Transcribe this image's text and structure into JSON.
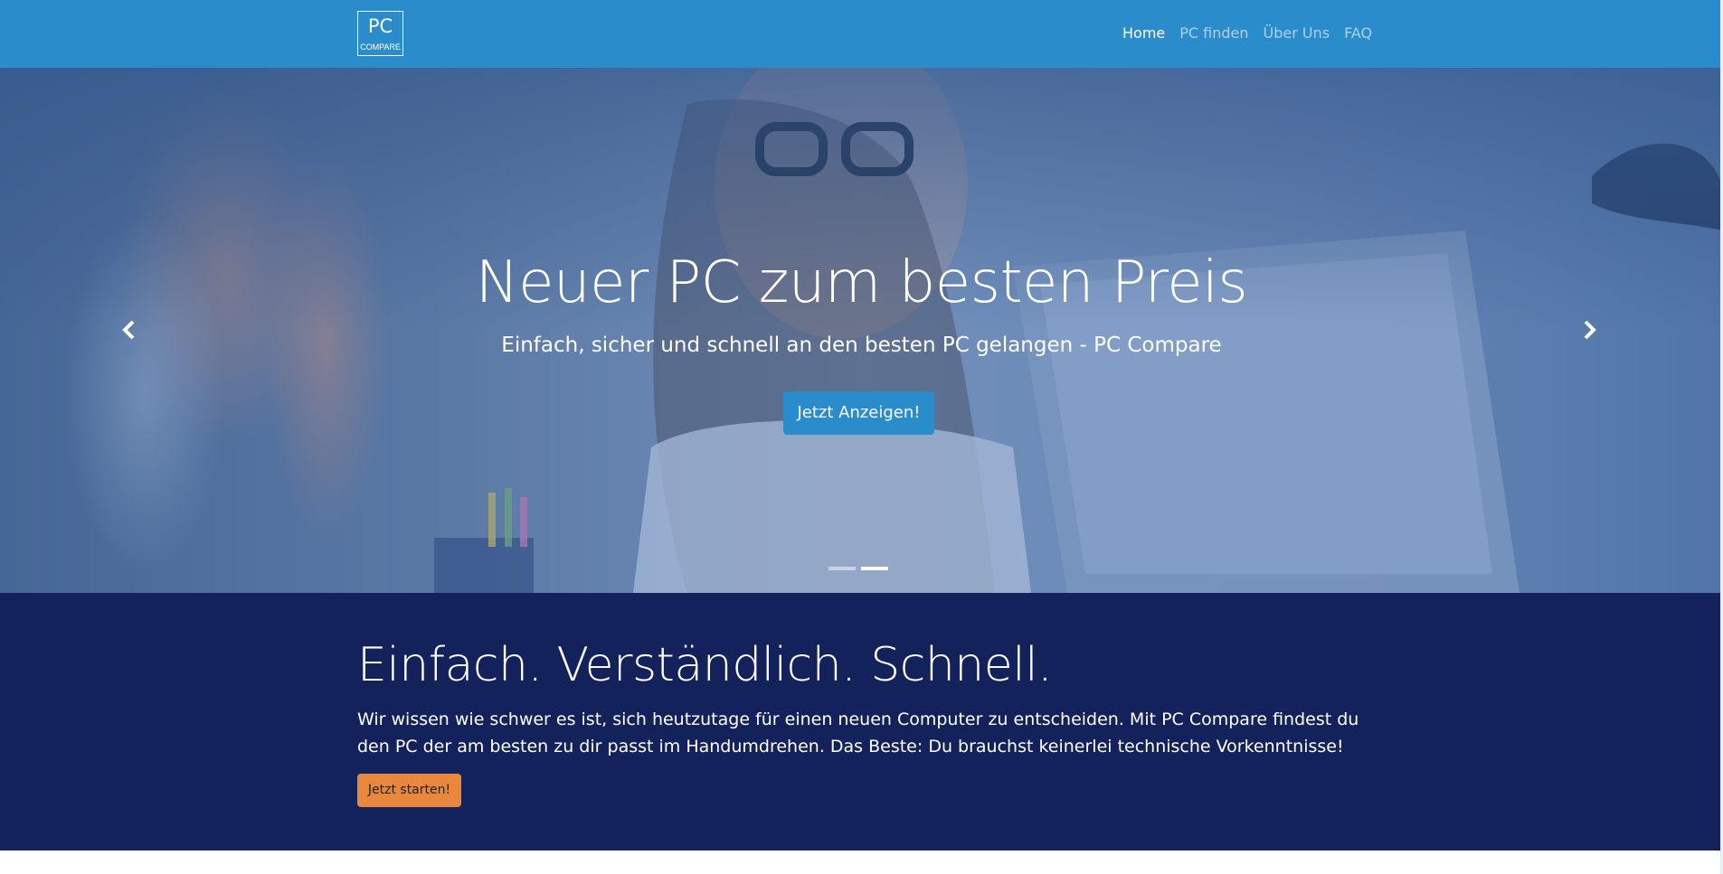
{
  "colors": {
    "navbar_bg": "#2b8ccc",
    "hero_button_bg": "#2b8ccc",
    "intro_bg": "#13225a",
    "intro_button_bg": "#e8883f"
  },
  "navbar": {
    "logo": {
      "line1": "PC",
      "line2": "COMPARE"
    },
    "links": [
      {
        "label": "Home",
        "active": true
      },
      {
        "label": "PC finden",
        "active": false
      },
      {
        "label": "Über Uns",
        "active": false
      },
      {
        "label": "FAQ",
        "active": false
      }
    ]
  },
  "hero": {
    "title": "Neuer PC zum besten Preis",
    "subtitle": "Einfach, sicher und schnell an den besten PC gelangen - PC Compare",
    "button_label": "Jetzt Anzeigen!",
    "slide_count": 2,
    "active_slide": 2,
    "prev_icon": "chevron-left-icon",
    "next_icon": "chevron-right-icon"
  },
  "intro": {
    "heading": "Einfach. Verständlich. Schnell.",
    "text": "Wir wissen wie schwer es ist, sich heutzutage für einen neuen Computer zu entscheiden. Mit PC Compare findest du den PC der am besten zu dir passt im Handumdrehen. Das Beste: Du brauchst keinerlei technische Vorkenntnisse!",
    "button_label": "Jetzt starten!"
  }
}
